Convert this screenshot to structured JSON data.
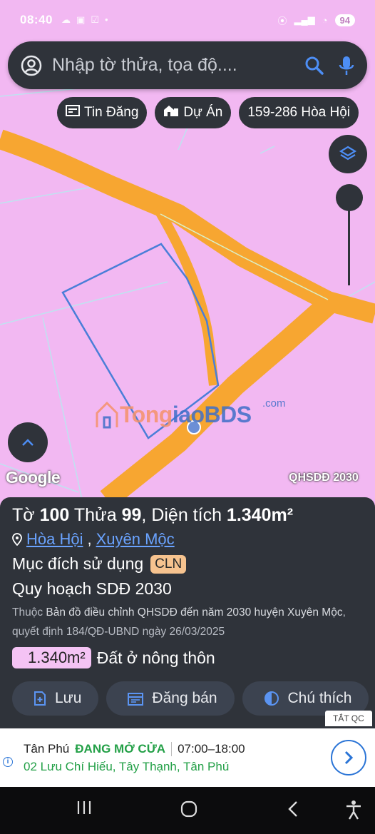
{
  "status_bar": {
    "time": "08:40",
    "battery": "94"
  },
  "search": {
    "placeholder": "Nhập tờ thửa, tọa độ...."
  },
  "chips": [
    {
      "label": "Tin Đăng",
      "icon": "news-icon"
    },
    {
      "label": "Dự Án",
      "icon": "building-icon"
    },
    {
      "label": "159-286 Hòa Hội",
      "icon": ""
    }
  ],
  "map": {
    "land_color": "#f2b8f2",
    "road_color": "#f7a631",
    "parcel_border_color": "#4a7ed8",
    "watermark": {
      "part_a": "Tong",
      "part_b": "iaoBDS",
      "suffix": ".com"
    },
    "attribution": "Google",
    "layer_badge": "QHSDĐ 2030"
  },
  "parcel": {
    "title_prefix": "Tờ ",
    "sheet": "100",
    "title_mid": " Thửa ",
    "plot": "99",
    "area_label": ", Diện tích ",
    "area": "1.340m²",
    "location_1": "Hòa Hội",
    "location_sep": ", ",
    "location_2": "Xuyên Mộc",
    "purpose_label": "Mục đích sử dụng",
    "purpose_code": "CLN",
    "plan_label": "Quy hoạch SDĐ 2030",
    "note_prefix": "Thuộc ",
    "note_map": "Bản đồ điều chỉnh QHSDĐ đến năm 2030 huyện Xuyên Mộc",
    "note_suffix": ", quyết định 184/QĐ-UBND ngày 26/03/2025",
    "zone_area": "1.340m²",
    "zone_type": "Đất ở nông thôn"
  },
  "actions": [
    {
      "label": "Lưu"
    },
    {
      "label": "Đăng bán"
    },
    {
      "label": "Chú thích"
    }
  ],
  "ad": {
    "close_label": "TẮT QC",
    "name": "Tân Phú",
    "status": "ĐANG MỞ CỬA",
    "hours": "07:00–18:00",
    "address": "02 Lưu Chí Hiếu, Tây Thạnh, Tân Phú"
  }
}
